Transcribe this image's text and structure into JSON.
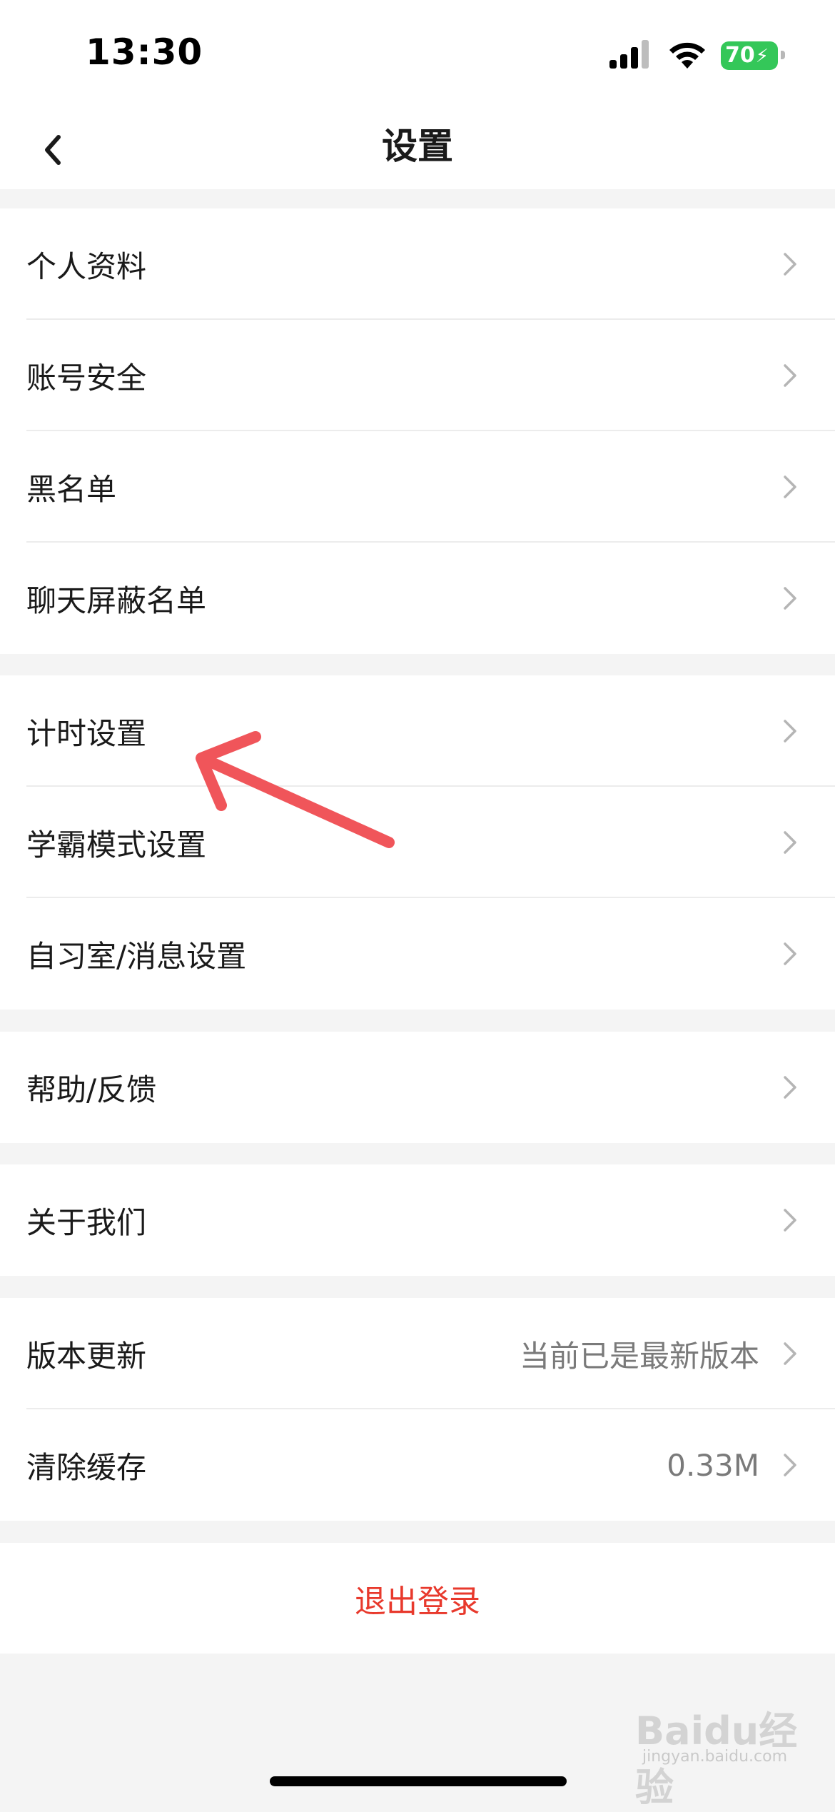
{
  "status_bar": {
    "time": "13:30",
    "battery": "70",
    "icons": [
      "signal-icon",
      "wifi-icon",
      "battery-icon"
    ]
  },
  "nav": {
    "title": "设置",
    "back_icon": "chevron-left-icon"
  },
  "groups": [
    {
      "items": [
        {
          "label": "个人资料"
        },
        {
          "label": "账号安全"
        },
        {
          "label": "黑名单"
        },
        {
          "label": "聊天屏蔽名单"
        }
      ]
    },
    {
      "items": [
        {
          "label": "计时设置"
        },
        {
          "label": "学霸模式设置"
        },
        {
          "label": "自习室/消息设置"
        }
      ]
    },
    {
      "items": [
        {
          "label": "帮助/反馈"
        }
      ]
    },
    {
      "items": [
        {
          "label": "关于我们"
        }
      ]
    },
    {
      "items": [
        {
          "label": "版本更新",
          "value": "当前已是最新版本"
        },
        {
          "label": "清除缓存",
          "value": "0.33M"
        }
      ]
    }
  ],
  "logout": {
    "label": "退出登录"
  },
  "colors": {
    "accent_red": "#e8392c",
    "annotation_arrow": "#f0555a",
    "battery_green": "#34c759"
  },
  "watermark": {
    "main": "Baidu经验",
    "sub": "jingyan.baidu.com"
  }
}
